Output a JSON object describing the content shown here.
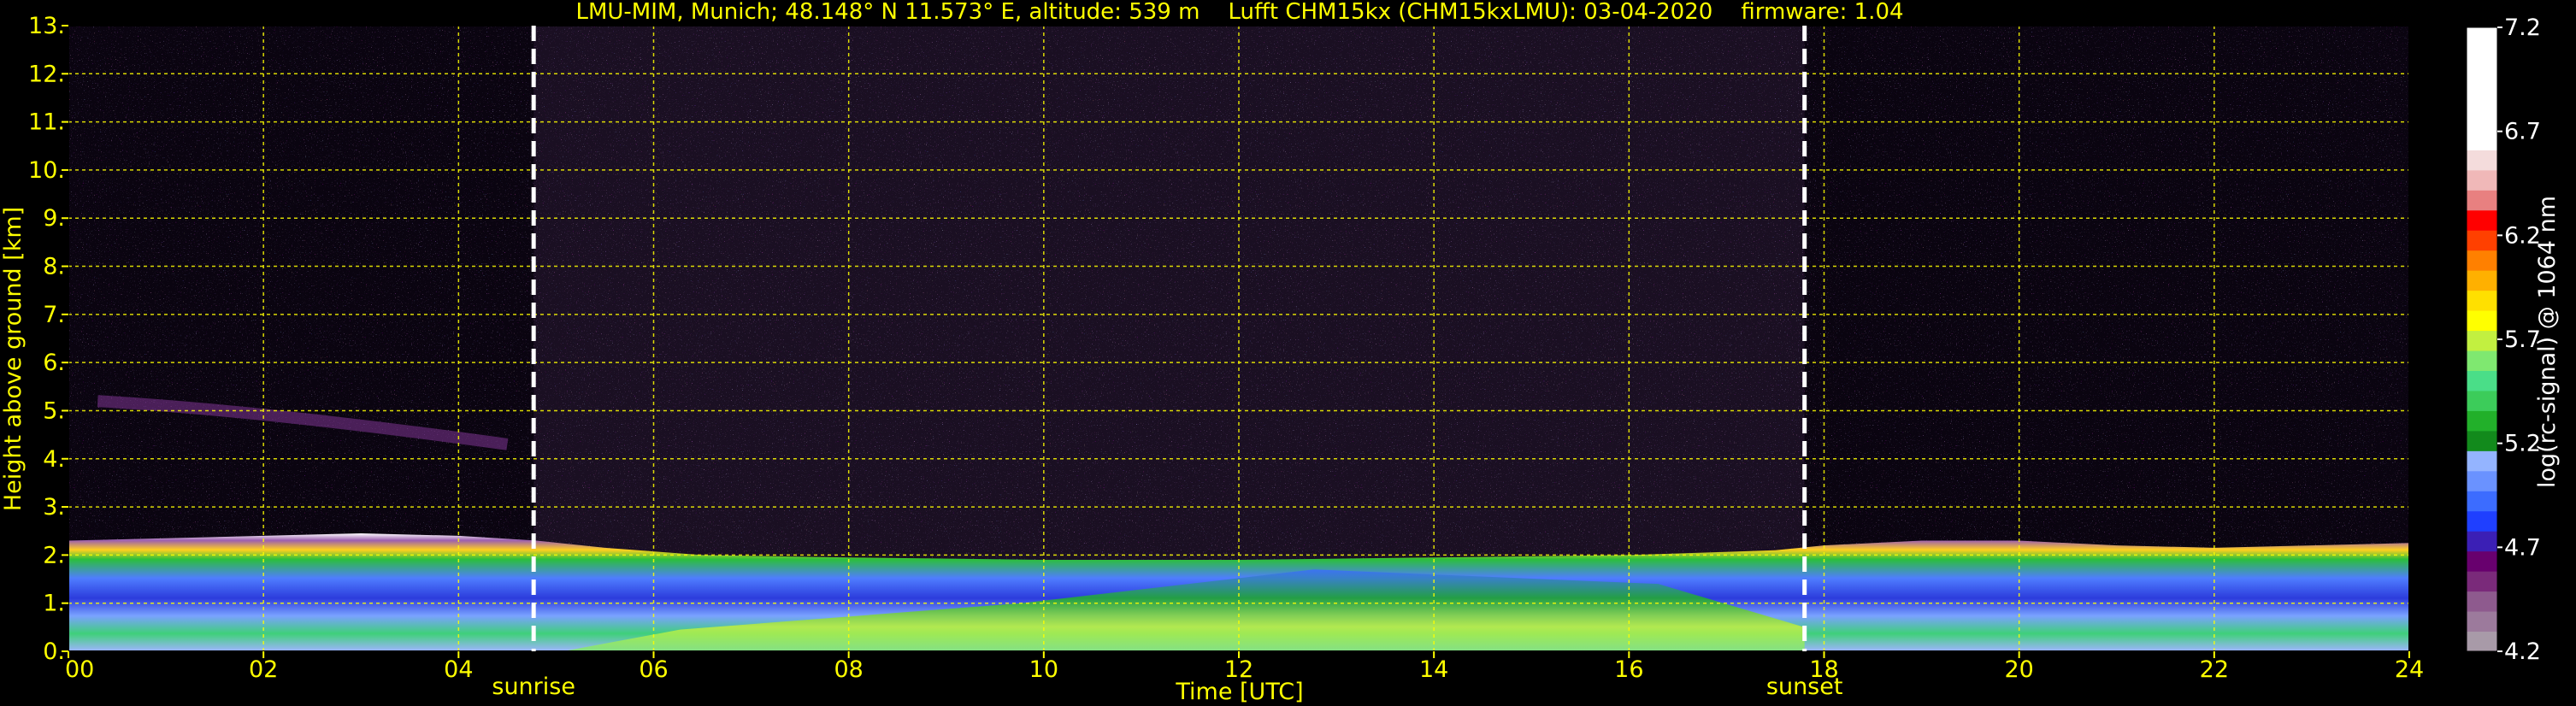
{
  "chart_data": {
    "type": "heatmap",
    "title": "LMU-MIM, Munich; 48.148° N 11.573° E, altitude: 539 m    Lufft CHM15kx (CHM15kxLMU): 03-04-2020    firmware: 1.04",
    "xlabel": "Time [UTC]",
    "ylabel": "Height above ground [km]",
    "xlim": [
      0,
      24
    ],
    "ylim": [
      0,
      13
    ],
    "x_ticks": [
      0,
      2,
      4,
      6,
      8,
      10,
      12,
      14,
      16,
      18,
      20,
      22,
      24
    ],
    "x_tick_labels": [
      "00",
      "02",
      "04",
      "06",
      "08",
      "10",
      "12",
      "14",
      "16",
      "18",
      "20",
      "22",
      "24"
    ],
    "y_ticks": [
      0,
      1,
      2,
      3,
      4,
      5,
      6,
      7,
      8,
      9,
      10,
      11,
      12,
      13
    ],
    "y_tick_labels": [
      "0.",
      "1.",
      "2.",
      "3.",
      "4.",
      "5.",
      "6.",
      "7.",
      "8.",
      "9.",
      "10.",
      "11.",
      "12.",
      "13."
    ],
    "grid": true,
    "grid_color": "#ffff00",
    "text_color": "#ffff00",
    "background": "#000000",
    "annotations": [
      {
        "label": "sunrise",
        "x": 4.77
      },
      {
        "label": "sunset",
        "x": 17.8
      }
    ],
    "colorbar": {
      "label": "log(rc-signal) @ 1064 nm",
      "range": [
        4.2,
        7.2
      ],
      "tick_values": [
        4.2,
        4.7,
        5.2,
        5.7,
        6.2,
        6.7,
        7.2
      ],
      "tick_labels": [
        "4.2",
        "4.7",
        "5.2",
        "5.7",
        "6.2",
        "6.7",
        "7.2"
      ],
      "colors": [
        "#a89aa8",
        "#9c7a9c",
        "#8e5a8e",
        "#7a2a7a",
        "#68006e",
        "#3b1fb5",
        "#1f3fff",
        "#3c6cff",
        "#6a92ff",
        "#94b4ff",
        "#128a1c",
        "#22b02a",
        "#3ccc5a",
        "#4ade88",
        "#7fe870",
        "#c2f040",
        "#ffff00",
        "#ffe000",
        "#ffb000",
        "#ff8000",
        "#ff4000",
        "#ff0000",
        "#e88080",
        "#f0b8b8",
        "#f4dcdc",
        "#ffffff",
        "#ffffff",
        "#ffffff"
      ],
      "color_value_max": 6.9
    },
    "boundary_layer_top_km": [
      [
        0,
        2.3
      ],
      [
        1,
        2.35
      ],
      [
        2,
        2.4
      ],
      [
        3,
        2.45
      ],
      [
        4,
        2.4
      ],
      [
        4.8,
        2.3
      ],
      [
        5.5,
        2.15
      ],
      [
        6.5,
        2.0
      ],
      [
        8,
        1.95
      ],
      [
        10,
        1.9
      ],
      [
        12,
        1.9
      ],
      [
        14,
        1.95
      ],
      [
        16,
        2.0
      ],
      [
        17.5,
        2.1
      ],
      [
        18,
        2.2
      ],
      [
        19,
        2.3
      ],
      [
        20,
        2.3
      ],
      [
        21,
        2.2
      ],
      [
        22,
        2.15
      ],
      [
        23,
        2.2
      ],
      [
        24,
        2.25
      ]
    ]
  }
}
